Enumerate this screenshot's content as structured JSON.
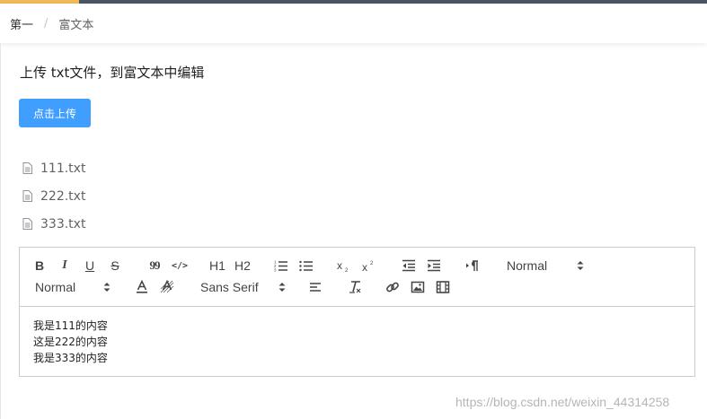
{
  "breadcrumb": {
    "items": [
      "第一",
      "富文本"
    ],
    "separator": "/"
  },
  "page": {
    "title": "上传 txt文件，到富文本中编辑"
  },
  "upload": {
    "button_label": "点击上传"
  },
  "files": [
    {
      "name": "111.txt"
    },
    {
      "name": "222.txt"
    },
    {
      "name": "333.txt"
    }
  ],
  "editor": {
    "toolbar": {
      "header_picker": "Normal",
      "size_picker": "Normal",
      "font_picker": "Sans Serif",
      "h1": "H1",
      "h2": "H2",
      "bold": "B",
      "italic": "I",
      "underline": "U",
      "strike": "S",
      "blockquote": "99",
      "code": "</>"
    },
    "content_lines": [
      "我是111的内容",
      "这是222的内容",
      "我是333的内容"
    ]
  },
  "watermark": "https://blog.csdn.net/weixin_44314258",
  "colors": {
    "primary": "#409eff",
    "accent": "#f0b95a",
    "topbar": "#4b5563"
  }
}
